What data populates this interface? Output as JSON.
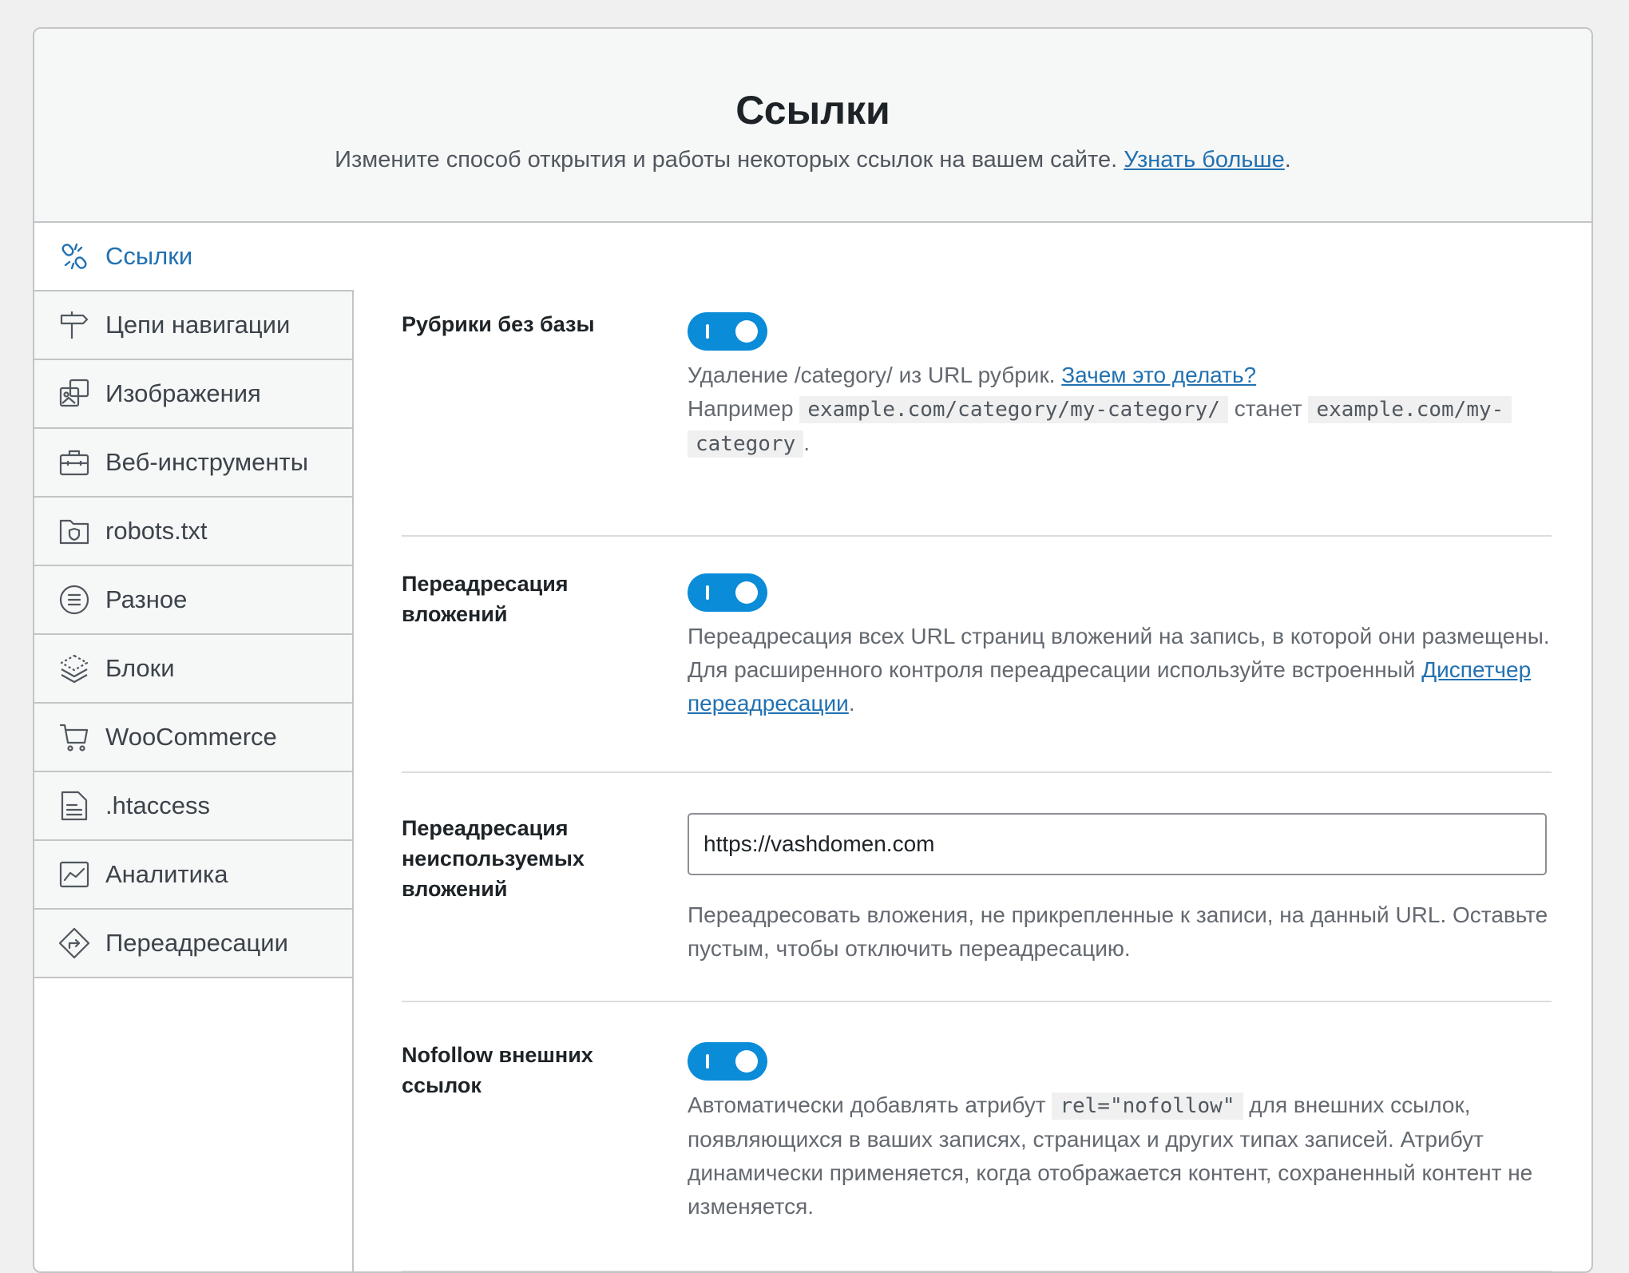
{
  "header": {
    "title": "Ссылки",
    "subtitle": "Измените способ открытия и работы некоторых ссылок на вашем сайте.",
    "learn_more": "Узнать больше",
    "period": "."
  },
  "sidebar": {
    "items": [
      {
        "label": "Ссылки",
        "icon": "links-icon",
        "active": true
      },
      {
        "label": "Цепи навигации",
        "icon": "signpost-icon"
      },
      {
        "label": "Изображения",
        "icon": "images-icon"
      },
      {
        "label": "Веб-инструменты",
        "icon": "toolbox-icon"
      },
      {
        "label": "robots.txt",
        "icon": "folder-shield-icon"
      },
      {
        "label": "Разное",
        "icon": "list-circle-icon"
      },
      {
        "label": "Блоки",
        "icon": "blocks-icon"
      },
      {
        "label": "WooCommerce",
        "icon": "cart-icon"
      },
      {
        "label": ".htaccess",
        "icon": "file-text-icon"
      },
      {
        "label": "Аналитика",
        "icon": "chart-icon"
      },
      {
        "label": "Переадресации",
        "icon": "redirect-icon"
      }
    ]
  },
  "settings": {
    "strip_category": {
      "title": "Рубрики без базы",
      "enabled": true,
      "desc_1": "Удаление /category/ из URL рубрик.",
      "why_link": "Зачем это делать?",
      "example_prefix": "Например",
      "example_from": "example.com/category/my-category/",
      "becomes": "станет",
      "example_to_1": "example.com/my-",
      "example_to_2": "category",
      "period": "."
    },
    "attachment_redirect": {
      "title": "Переадресация вложений",
      "enabled": true,
      "desc": "Переадресация всех URL страниц вложений на запись, в которой они размещены. Для расширенного контроля переадресации используйте встроенный",
      "link": "Диспетчер переадресации",
      "period": "."
    },
    "orphan_redirect": {
      "title": "Переадресация неиспользуемых вложений",
      "value": "https://vashdomen.com",
      "desc": "Переадресовать вложения, не прикрепленные к записи, на данный URL. Оставьте пустым, чтобы отключить переадресацию."
    },
    "nofollow": {
      "title": "Nofollow внешних ссылок",
      "enabled": true,
      "desc_1": "Автоматически добавлять атрибут",
      "code": "rel=\"nofollow\"",
      "desc_2": "для внешних ссылок, появляющихся в ваших записях, страницах и других типах записей. Атрибут динамически применяется, когда отображается контент, сохраненный контент не изменяется."
    }
  },
  "colors": {
    "accent": "#2271b1",
    "toggle_on": "#0a8cd8"
  }
}
